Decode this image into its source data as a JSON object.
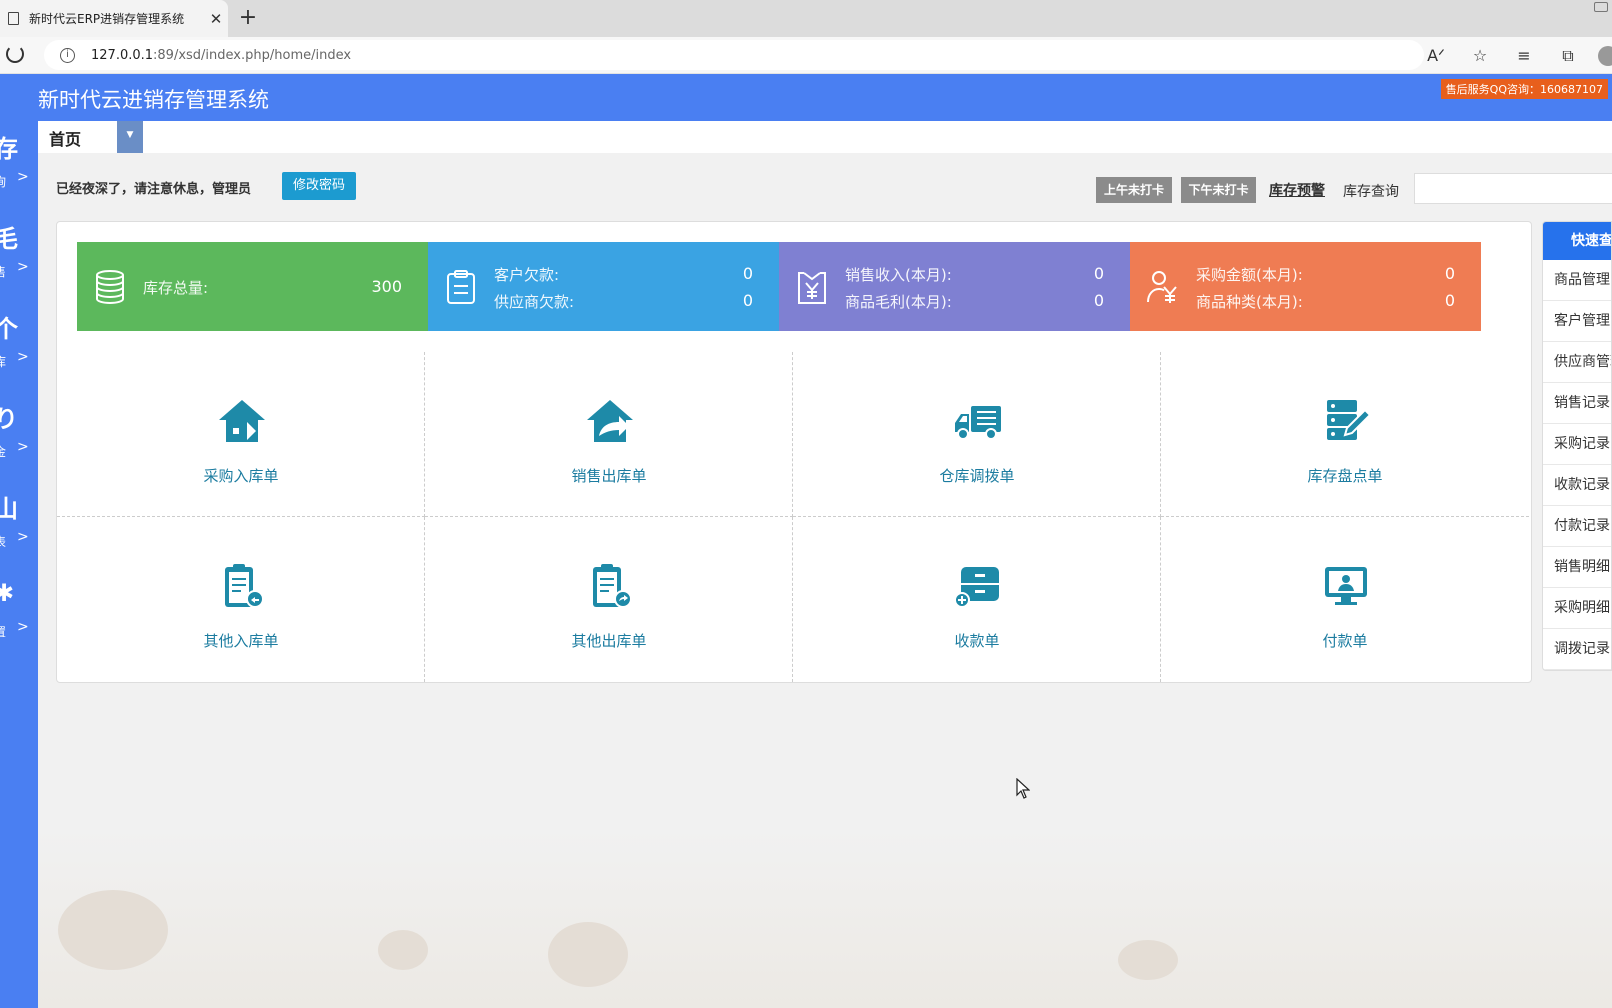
{
  "browser": {
    "tab_title": "新时代云ERP进销存管理系统",
    "tab_close": "✕",
    "new_tab": "+",
    "url_host": "127.0.0.1",
    "url_rest": ":89/xsd/index.php/home/index"
  },
  "app": {
    "title": "新时代云进销存管理系统",
    "qq_service": "售后服务QQ咨询：160687107"
  },
  "sidebar": {
    "items": [
      {
        "glyph": "存",
        "label": "询",
        "chevron": ">"
      },
      {
        "glyph": "毛",
        "label": "售",
        "chevron": ">"
      },
      {
        "glyph": "个",
        "label": "库",
        "chevron": ">"
      },
      {
        "glyph": "り",
        "label": "金",
        "chevron": ">"
      },
      {
        "glyph": "山",
        "label": "表",
        "chevron": ">"
      },
      {
        "glyph": "✱",
        "label": "置",
        "chevron": ">"
      }
    ]
  },
  "tabs": {
    "home": "首页",
    "dropdown": "▼"
  },
  "notice": {
    "text": "已经夜深了，请注意休息，管理员",
    "change_password": "修改密码",
    "morning_clock": "上午未打卡",
    "afternoon_clock": "下午未打卡",
    "stock_warning": "库存预警",
    "stock_query_label": "库存查询",
    "stock_query_value": ""
  },
  "stats": [
    {
      "color": "#5cb85c",
      "icon": "coins-icon",
      "rows": [
        {
          "label": "库存总量:",
          "value": "300"
        }
      ]
    },
    {
      "color": "#3aa3e3",
      "icon": "clipboard-icon",
      "rows": [
        {
          "label": "客户欠款:",
          "value": "0"
        },
        {
          "label": "供应商欠款:",
          "value": "0"
        }
      ]
    },
    {
      "color": "#7f80d2",
      "icon": "yen-document-icon",
      "rows": [
        {
          "label": "销售收入(本月):",
          "value": "0"
        },
        {
          "label": "商品毛利(本月):",
          "value": "0"
        }
      ]
    },
    {
      "color": "#ef7c53",
      "icon": "yen-person-icon",
      "rows": [
        {
          "label": "采购金额(本月):",
          "value": "0"
        },
        {
          "label": "商品种类(本月):",
          "value": "0"
        }
      ]
    }
  ],
  "actions": [
    {
      "label": "采购入库单",
      "icon": "house-in-icon"
    },
    {
      "label": "销售出库单",
      "icon": "house-out-icon"
    },
    {
      "label": "仓库调拨单",
      "icon": "truck-icon"
    },
    {
      "label": "库存盘点单",
      "icon": "server-edit-icon"
    },
    {
      "label": "其他入库单",
      "icon": "clipboard-in-icon"
    },
    {
      "label": "其他出库单",
      "icon": "clipboard-out-icon"
    },
    {
      "label": "收款单",
      "icon": "cabinet-add-icon"
    },
    {
      "label": "付款单",
      "icon": "monitor-user-icon"
    }
  ],
  "quick": {
    "title": "快速查询",
    "items": [
      "商品管理",
      "客户管理",
      "供应商管理",
      "销售记录",
      "采购记录",
      "收款记录",
      "付款记录",
      "销售明细",
      "采购明细",
      "调拨记录"
    ]
  },
  "colors": {
    "header": "#4a7ff2",
    "accent": "#1c9bd0",
    "icon_teal": "#1e8aa8"
  }
}
